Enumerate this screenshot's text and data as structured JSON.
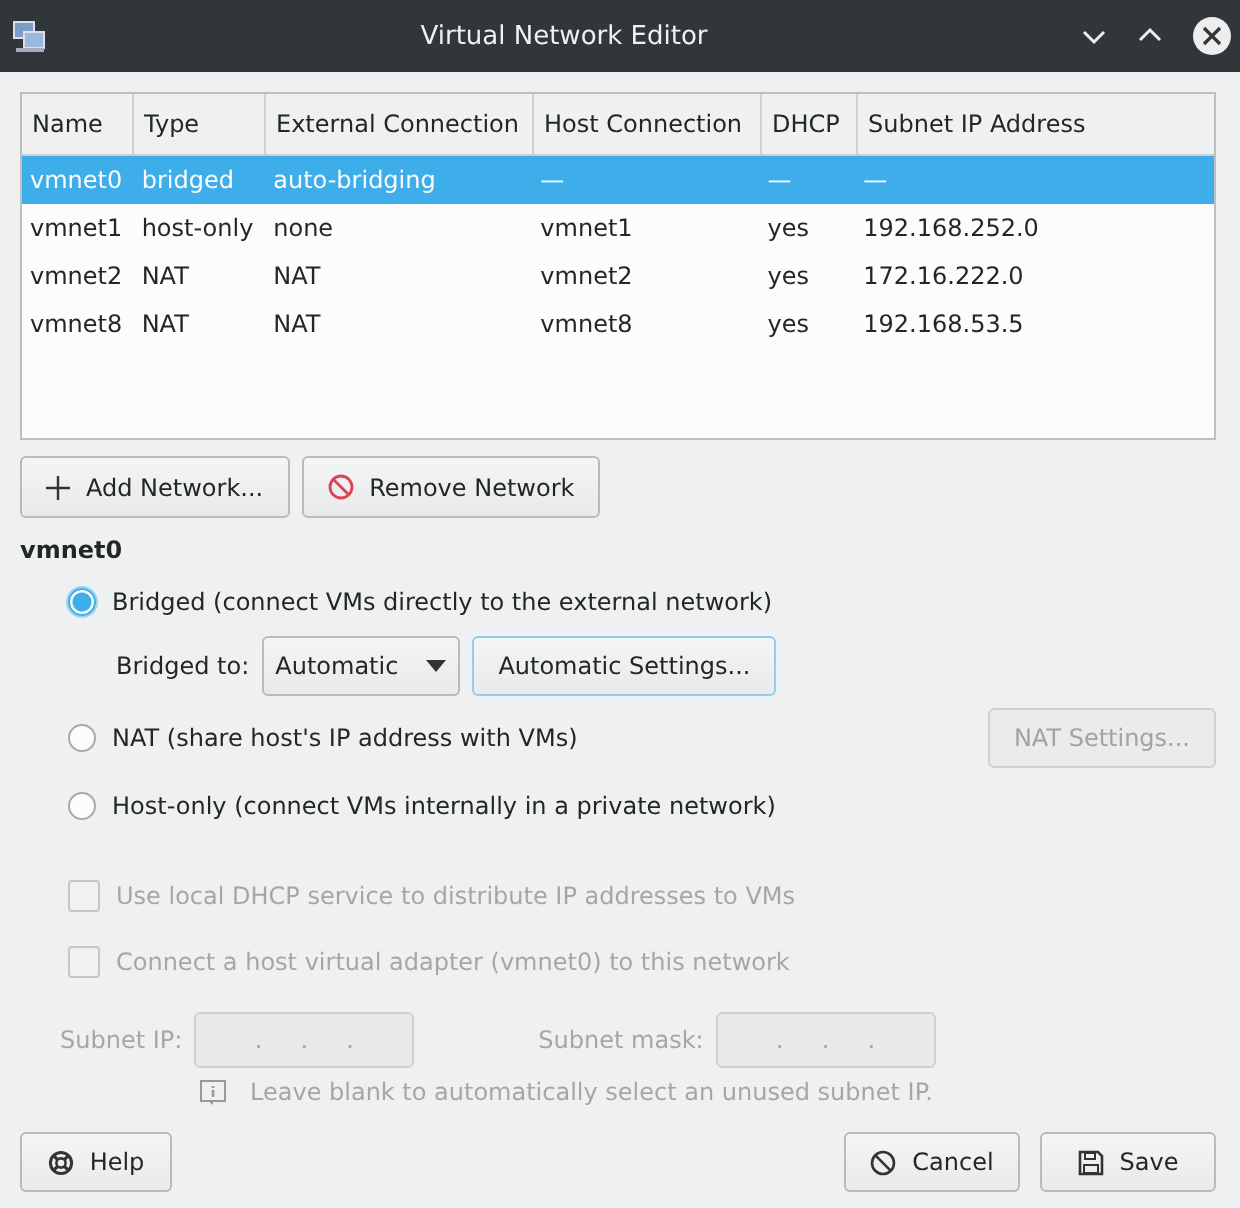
{
  "window": {
    "title": "Virtual Network Editor"
  },
  "table": {
    "columns": [
      "Name",
      "Type",
      "External Connection",
      "Host Connection",
      "DHCP",
      "Subnet IP Address"
    ],
    "rows": [
      {
        "cells": [
          "vmnet0",
          "bridged",
          "auto-bridging",
          "—",
          "—",
          "—"
        ],
        "selected": true
      },
      {
        "cells": [
          "vmnet1",
          "host-only",
          "none",
          "vmnet1",
          "yes",
          "192.168.252.0"
        ],
        "selected": false
      },
      {
        "cells": [
          "vmnet2",
          "NAT",
          "NAT",
          "vmnet2",
          "yes",
          "172.16.222.0"
        ],
        "selected": false
      },
      {
        "cells": [
          "vmnet8",
          "NAT",
          "NAT",
          "vmnet8",
          "yes",
          "192.168.53.5"
        ],
        "selected": false
      }
    ]
  },
  "network_buttons": [
    {
      "label": "Add Network...",
      "kind": "add"
    },
    {
      "label": "Remove Network",
      "kind": "remove"
    }
  ],
  "section_title": "vmnet0",
  "modes": [
    {
      "label": "Bridged (connect VMs directly to the external network)",
      "selected": true,
      "kind": "bridged"
    },
    {
      "label": "NAT (share host's IP address with VMs)",
      "selected": false,
      "kind": "nat"
    },
    {
      "label": "Host-only (connect VMs internally in a private network)",
      "selected": false,
      "kind": "hostonly"
    }
  ],
  "bridged_to": {
    "label": "Bridged to:",
    "value": "Automatic",
    "settings_button": "Automatic Settings..."
  },
  "nat_settings": {
    "label": "NAT Settings...",
    "disabled": true
  },
  "options": [
    {
      "label": "Use local DHCP service to distribute IP addresses to VMs",
      "checked": false,
      "disabled": true
    },
    {
      "label": "Connect a host virtual adapter (vmnet0) to this network",
      "checked": false,
      "disabled": true
    }
  ],
  "subnet_ip": {
    "label": "Subnet IP:",
    "value": ".     .     .",
    "disabled": true
  },
  "subnet_mask": {
    "label": "Subnet mask:",
    "value": ".     .     .",
    "disabled": true
  },
  "hint": "Leave blank to automatically select an unused subnet IP.",
  "footer_buttons": [
    {
      "label": "Help",
      "kind": "help"
    },
    {
      "label": "Cancel",
      "kind": "cancel"
    },
    {
      "label": "Save",
      "kind": "save"
    }
  ]
}
